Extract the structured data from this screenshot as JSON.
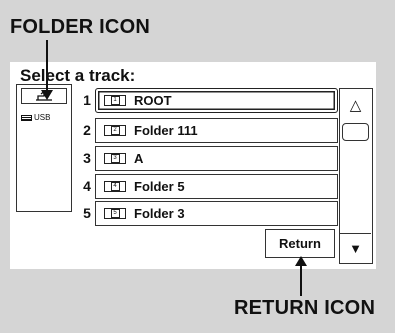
{
  "callouts": {
    "folder_icon": "FOLDER ICON",
    "return_icon": "RETURN ICON"
  },
  "screen": {
    "prompt": "Select a track:",
    "side_panel": {
      "up_folder_icon": "folder-up-icon",
      "usb_icon": "usb-icon",
      "usb_label": "USB"
    },
    "tracks": [
      {
        "number": "1",
        "folder_no": "1",
        "label": "ROOT",
        "selected": true
      },
      {
        "number": "2",
        "folder_no": "2",
        "label": "Folder 111",
        "selected": false
      },
      {
        "number": "3",
        "folder_no": "3",
        "label": "A",
        "selected": false
      },
      {
        "number": "4",
        "folder_no": "4",
        "label": "Folder 5",
        "selected": false
      },
      {
        "number": "5",
        "folder_no": "5",
        "label": "Folder 3",
        "selected": false
      }
    ],
    "scroll": {
      "up_glyph": "△",
      "down_glyph": "▼"
    },
    "return_label": "Return"
  }
}
